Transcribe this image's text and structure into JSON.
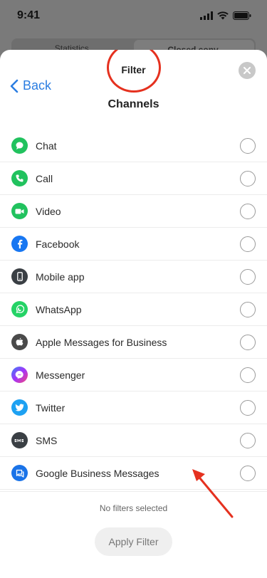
{
  "status_bar": {
    "time": "9:41"
  },
  "background_tabs": [
    {
      "label": "Statistics"
    },
    {
      "label": "Closed conv."
    }
  ],
  "sheet": {
    "title": "Filter",
    "back_label": "Back",
    "subtitle": "Channels"
  },
  "channels": [
    {
      "label": "Chat",
      "icon": "chat-icon",
      "color": "#21c25e"
    },
    {
      "label": "Call",
      "icon": "phone-icon",
      "color": "#21c25e"
    },
    {
      "label": "Video",
      "icon": "video-icon",
      "color": "#21c25e"
    },
    {
      "label": "Facebook",
      "icon": "facebook-icon",
      "color": "#1877f2"
    },
    {
      "label": "Mobile app",
      "icon": "mobile-app-icon",
      "color": "#3a3f44"
    },
    {
      "label": "WhatsApp",
      "icon": "whatsapp-icon",
      "color": "#25d366"
    },
    {
      "label": "Apple Messages for Business",
      "icon": "apple-icon",
      "color": "#4a4a4a"
    },
    {
      "label": "Messenger",
      "icon": "messenger-icon",
      "color": "#a334fa"
    },
    {
      "label": "Twitter",
      "icon": "twitter-icon",
      "color": "#1da1f2"
    },
    {
      "label": "SMS",
      "icon": "sms-icon",
      "color": "#3a3f44"
    },
    {
      "label": "Google Business Messages",
      "icon": "google-business-messages-icon",
      "color": "#1a73e8"
    }
  ],
  "footer": {
    "status": "No filters selected",
    "apply_label": "Apply Filter"
  },
  "colors": {
    "accent": "#2b7de1",
    "annotation": "#e5311f"
  }
}
